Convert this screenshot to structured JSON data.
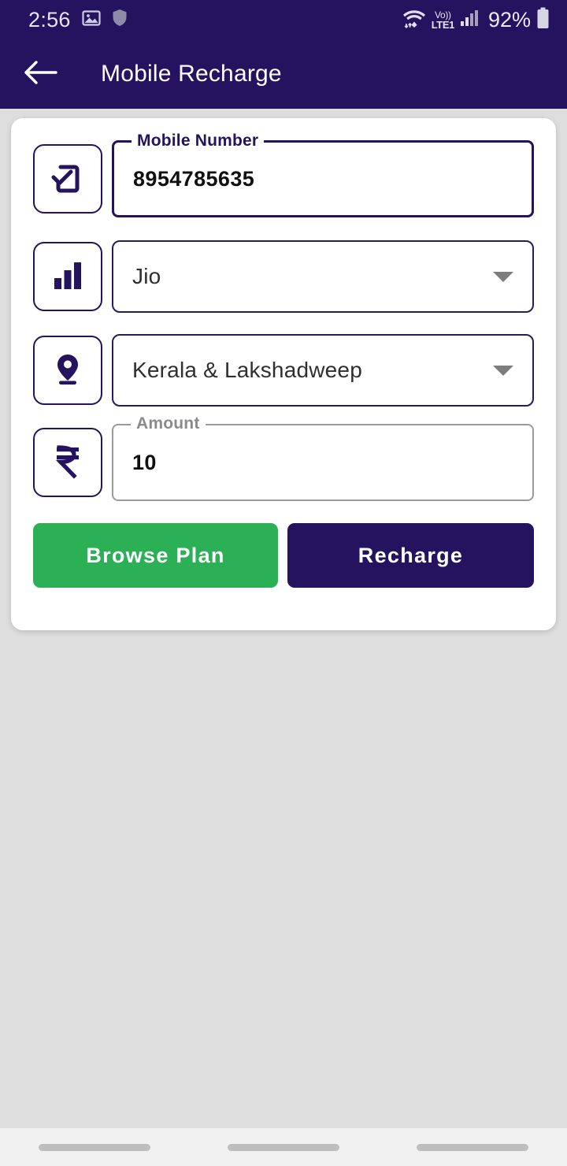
{
  "status_bar": {
    "time": "2:56",
    "left_icons": [
      "image-icon",
      "shield-icon"
    ],
    "wifi_icon": "wifi-icon",
    "volte_top": "Vo))",
    "volte_bottom": "LTE1",
    "signal_icon": "signal-bars-icon",
    "battery_percent": "92%",
    "battery_icon": "battery-icon"
  },
  "app_bar": {
    "back_icon": "back-arrow-icon",
    "title": "Mobile Recharge"
  },
  "form": {
    "mobile_number": {
      "icon": "phone-check-icon",
      "legend": "Mobile Number",
      "value": "8954785635",
      "placeholder": "Mobile Number"
    },
    "operator": {
      "icon": "signal-bars-icon",
      "value": "Jio",
      "caret": "chevron-down-icon"
    },
    "circle": {
      "icon": "location-pin-icon",
      "value": "Kerala & Lakshadweep",
      "caret": "chevron-down-icon"
    },
    "amount": {
      "icon": "rupee-icon",
      "legend": "Amount",
      "value": "10",
      "placeholder": "Amount"
    }
  },
  "actions": {
    "browse_plan": "Browse Plan",
    "recharge": "Recharge"
  },
  "colors": {
    "primary_navy": "#251360",
    "accent_green": "#2bb055",
    "page_background": "#dedede",
    "card_background": "#ffffff",
    "legend_gray": "#8b8b8b"
  }
}
